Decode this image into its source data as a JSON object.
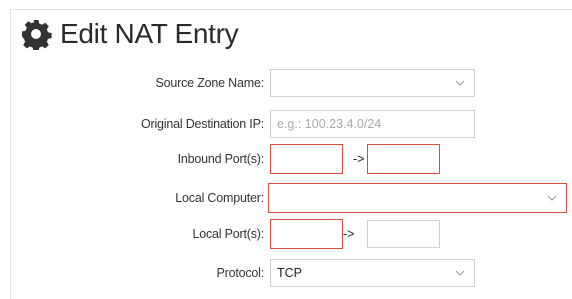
{
  "header": {
    "title": "Edit NAT Entry",
    "icon": "gear-icon"
  },
  "form": {
    "source_zone": {
      "label": "Source Zone Name:",
      "value": ""
    },
    "original_dest_ip": {
      "label": "Original Destination IP:",
      "value": "",
      "placeholder": "e.g.: 100.23.4.0/24"
    },
    "inbound_ports": {
      "label": "Inbound Port(s):",
      "from": "",
      "separator": "->",
      "to": ""
    },
    "local_computer": {
      "label": "Local Computer:",
      "value": ""
    },
    "local_ports": {
      "label": "Local Port(s):",
      "from": "",
      "separator": "->",
      "to": ""
    },
    "protocol": {
      "label": "Protocol:",
      "value": "TCP"
    }
  },
  "colors": {
    "error_border": "#d2503f",
    "normal_border": "#cfcfcf",
    "icon": "#333333"
  }
}
